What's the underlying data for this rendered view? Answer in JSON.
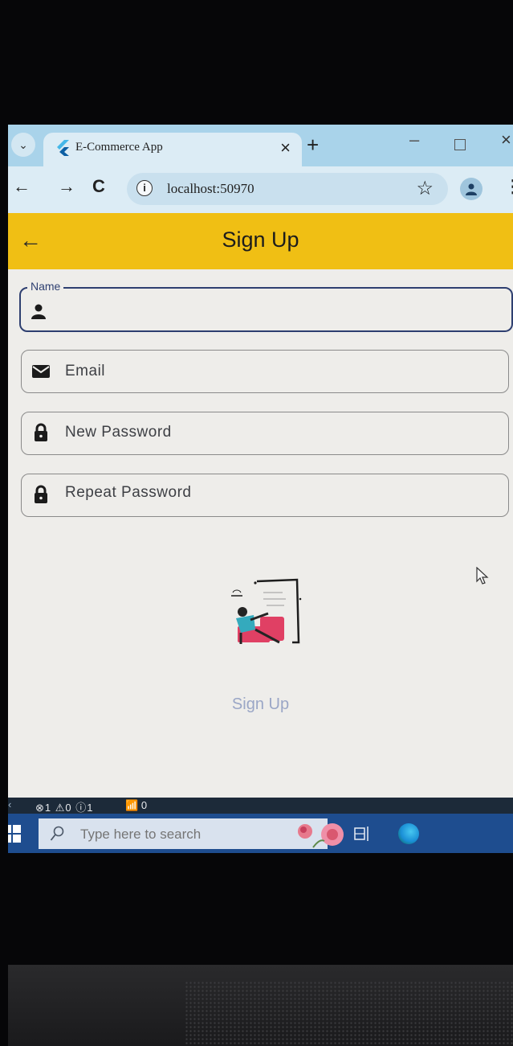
{
  "browser": {
    "tab_title": "E-Commerce App",
    "tab_close": "×",
    "new_tab": "+",
    "url": "localhost:50970"
  },
  "app": {
    "back_arrow": "←",
    "title": "Sign Up"
  },
  "form": {
    "name": {
      "label": "Name",
      "value": "",
      "icon": "person-icon"
    },
    "email": {
      "placeholder": "Email",
      "icon": "mail-icon"
    },
    "new_password": {
      "placeholder": "New Password",
      "icon": "lock-icon"
    },
    "repeat_password": {
      "placeholder": "Repeat Password",
      "icon": "lock-icon"
    },
    "submit_label": "Sign Up"
  },
  "status_bar": {
    "problems": "⊗1 ⚠0 ⓘ1",
    "ports": "0"
  },
  "taskbar": {
    "search_placeholder": "Type here to search"
  },
  "colors": {
    "appbar": "#f0bf14",
    "focused_border": "#2e3f70",
    "submit_text": "#9aa6c6",
    "taskbar": "#1e4d8f"
  }
}
